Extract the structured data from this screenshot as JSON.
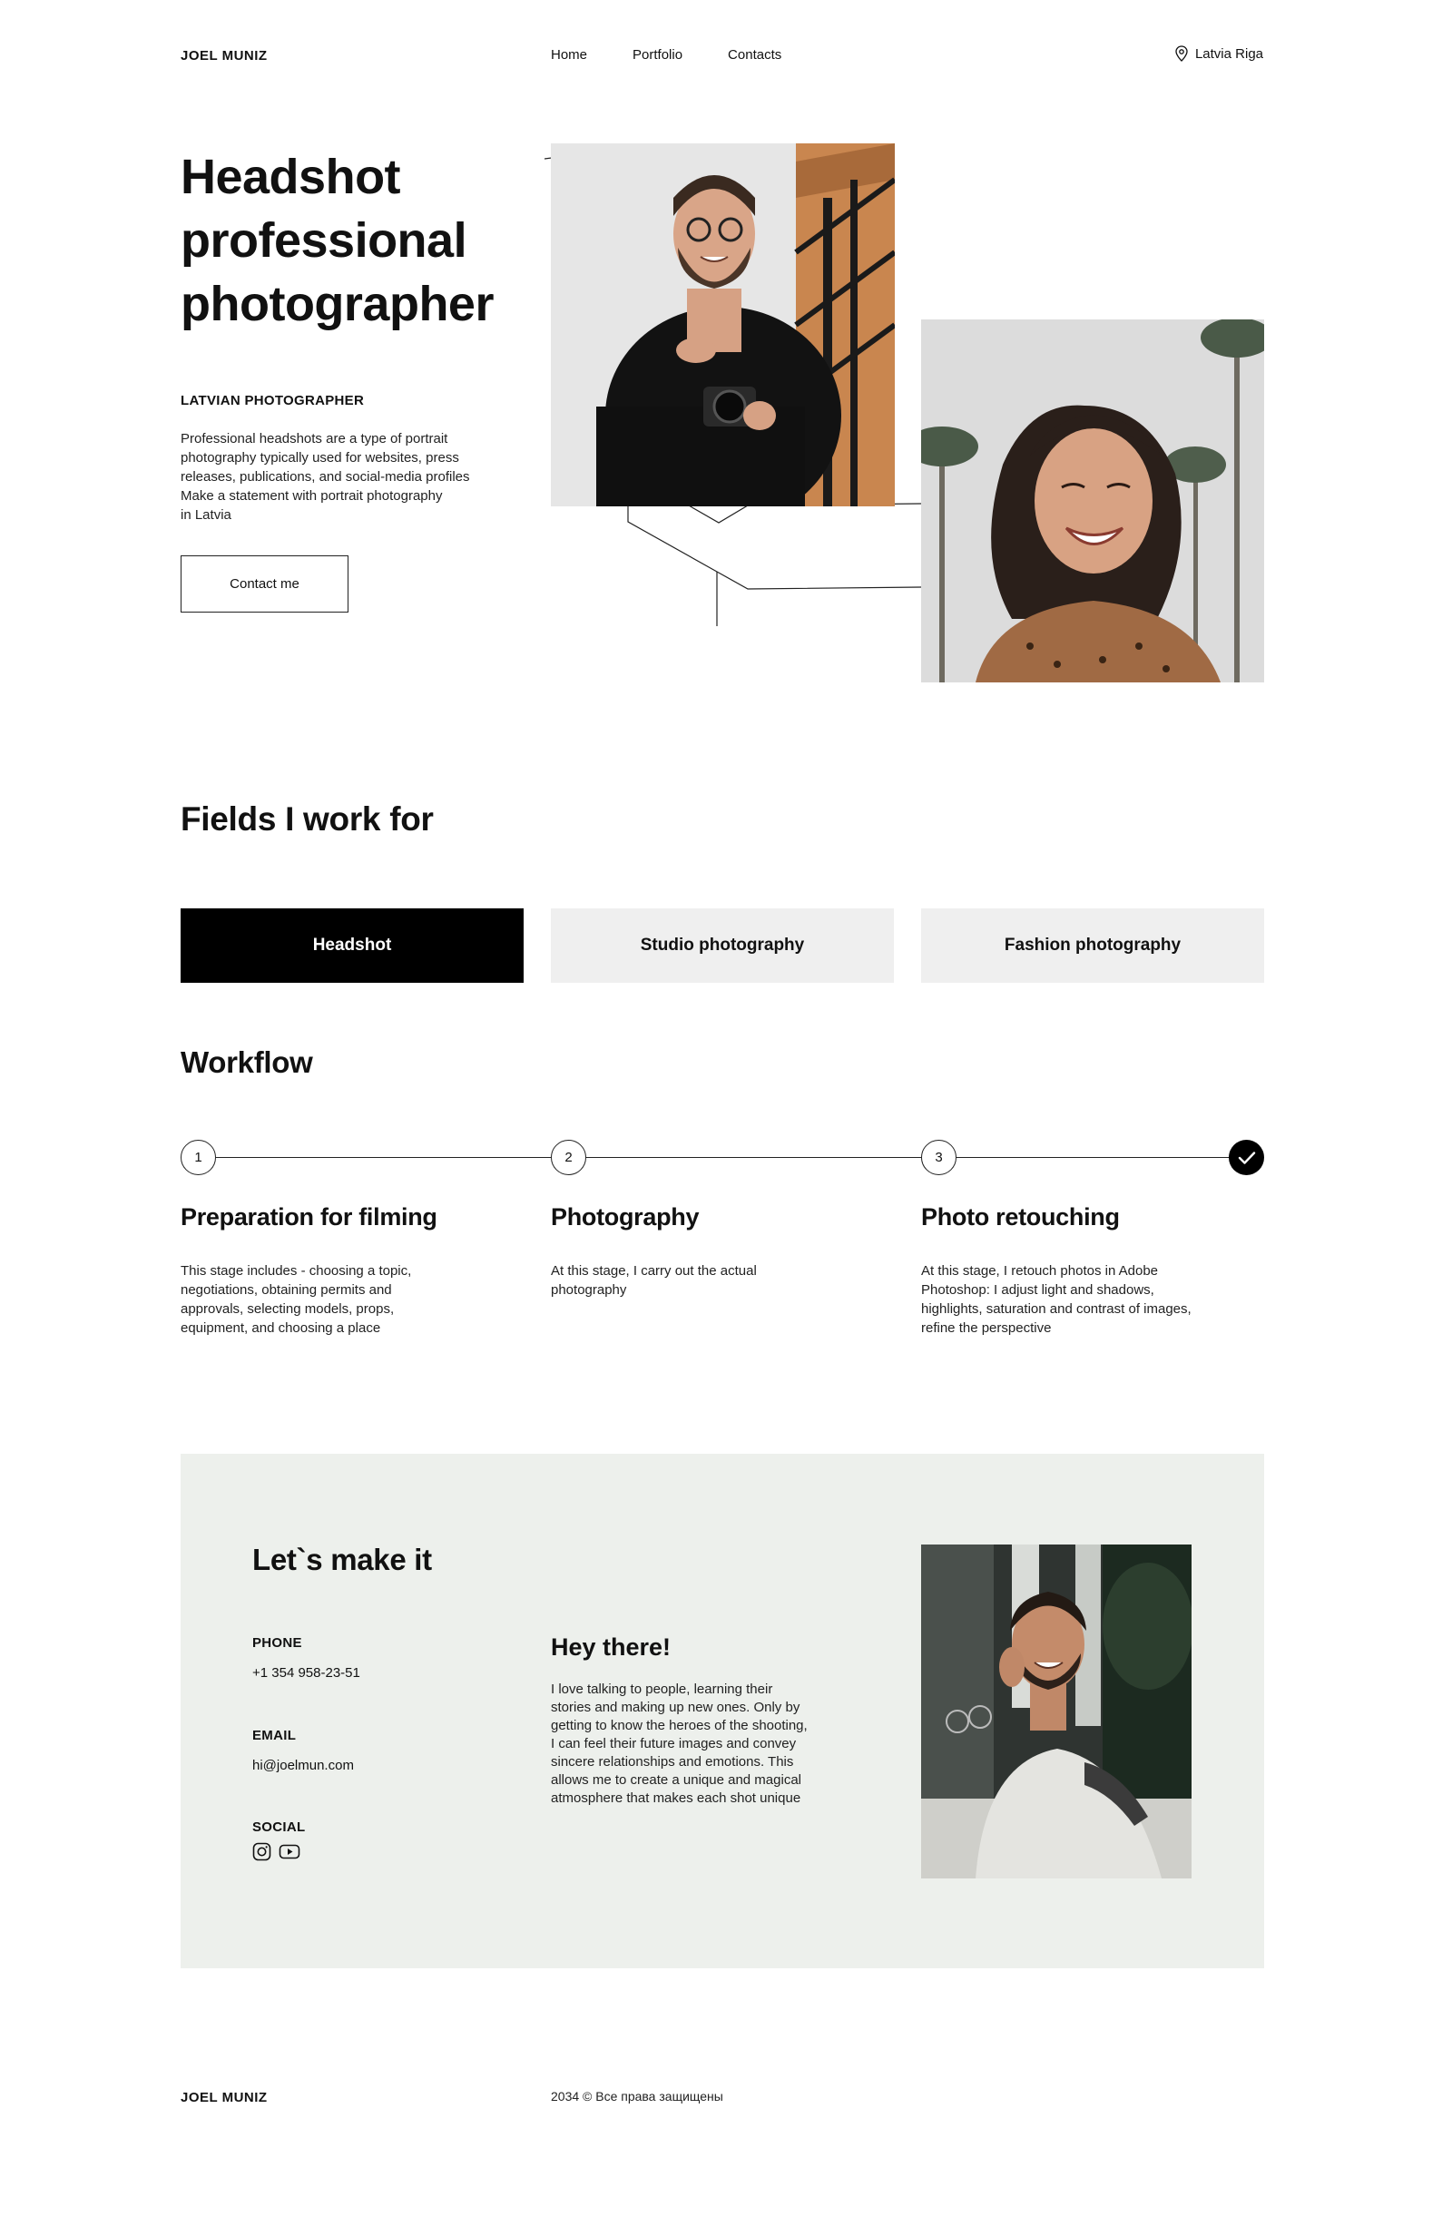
{
  "header": {
    "logo": "JOEL MUNIZ",
    "nav": [
      "Home",
      "Portfolio",
      "Contacts"
    ],
    "location": "Latvia Riga",
    "location_icon": "map-pin-icon"
  },
  "hero": {
    "title": "Headshot professional photographer",
    "subtitle": "LATVIAN PHOTOGRAPHER",
    "description": "Professional headshots are a type of portrait\nphotography typically used for websites, press\nreleases, publications, and social-media profiles\nMake a statement with portrait photography\nin Latvia",
    "cta": "Contact me"
  },
  "fields": {
    "title": "Fields I work for",
    "tabs": [
      {
        "label": "Headshot",
        "active": true
      },
      {
        "label": "Studio photography",
        "active": false
      },
      {
        "label": "Fashion photography",
        "active": false
      }
    ]
  },
  "workflow": {
    "title": "Workflow",
    "steps": [
      {
        "num": "1",
        "title": "Preparation for filming",
        "text": "This stage includes - choosing a topic, negotiations, obtaining permits and approvals, selecting models, props, equipment, and choosing a place"
      },
      {
        "num": "2",
        "title": "Photography",
        "text": "At this stage, I carry out the actual photography"
      },
      {
        "num": "3",
        "title": "Photo retouching",
        "text": "At this stage, I retouch photos in Adobe Photoshop: I adjust light and shadows, highlights, saturation and contrast of images, refine the perspective"
      }
    ],
    "done_icon": "checkmark-icon"
  },
  "contact": {
    "title": "Let`s make it",
    "phone_label": "PHONE",
    "phone": "+1 354 958-23-51",
    "email_label": "EMAIL",
    "email": "hi@joelmun.com",
    "social_label": "SOCIAL",
    "social_icons": [
      "instagram-icon",
      "youtube-icon"
    ],
    "hey_title": "Hey there!",
    "hey_text": "I love talking to people, learning their stories and making up new ones. Only by getting to know the heroes of the shooting, I can feel their future images and convey sincere relationships and emotions. This allows me to create a unique and magical atmosphere that makes each shot unique",
    "panel_color": "#edf0ec"
  },
  "footer": {
    "logo": "JOEL MUNIZ",
    "copyright": "2034 © Все права защищены"
  }
}
